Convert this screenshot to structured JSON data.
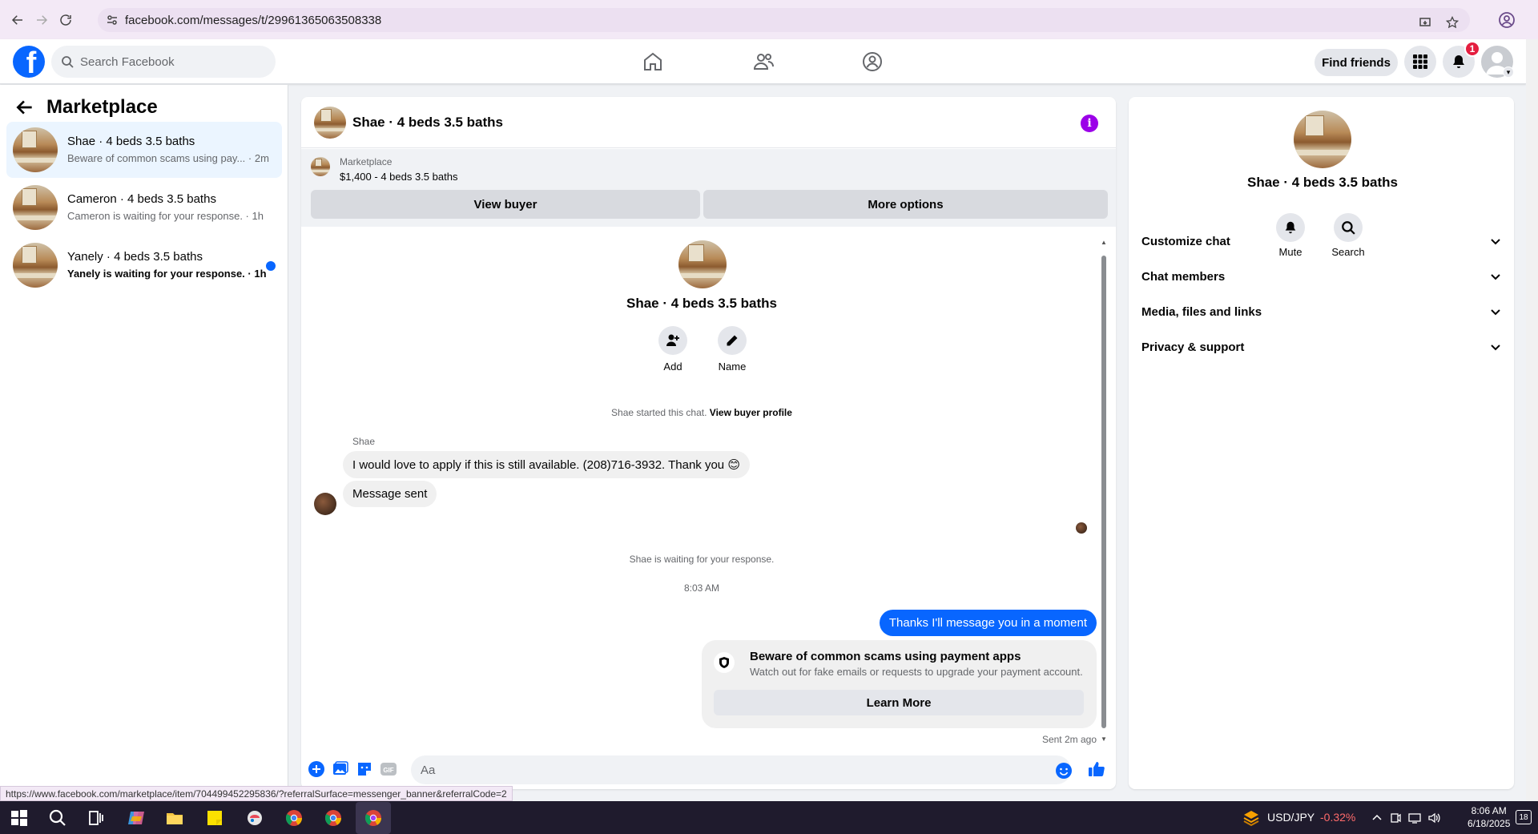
{
  "browser": {
    "url": "facebook.com/messages/t/29961365063508338",
    "status_url": "https://www.facebook.com/marketplace/item/704499452295836/?referralSurface=messenger_banner&referralCode=2"
  },
  "header": {
    "search_placeholder": "Search Facebook",
    "find_friends": "Find friends",
    "notification_count": "1"
  },
  "sidebar": {
    "title": "Marketplace",
    "conversations": [
      {
        "title": "Shae · 4 beds 3.5 baths",
        "preview": "Beware of common scams using pay... · 2m",
        "unread": false,
        "active": true
      },
      {
        "title": "Cameron · 4 beds 3.5 baths",
        "preview": "Cameron is waiting for your response. · 1h",
        "unread": false,
        "active": false
      },
      {
        "title": "Yanely · 4 beds 3.5 baths",
        "preview": "Yanely is waiting for your response. · 1h",
        "unread": true,
        "active": false
      }
    ]
  },
  "chat": {
    "title": "Shae · 4 beds 3.5 baths",
    "marketplace_label": "Marketplace",
    "listing": "$1,400 - 4 beds 3.5 baths",
    "view_buyer": "View buyer",
    "more_options": "More options",
    "profile_name": "Shae · 4 beds 3.5 baths",
    "add_label": "Add",
    "name_label": "Name",
    "started_text": "Shae started this chat.",
    "view_buyer_profile": "View buyer profile",
    "sender": "Shae",
    "msg1": "I would love to apply if this is still available. (208)716-3932. Thank you 😊",
    "msg2": "Message sent",
    "waiting": "Shae is waiting for your response.",
    "time": "8:03 AM",
    "reply": "Thanks I'll message you in a moment",
    "scam_title": "Beware of common scams using payment apps",
    "scam_sub": "Watch out for fake emails or requests to upgrade your payment account.",
    "learn_more": "Learn More",
    "sent_ago": "Sent 2m ago",
    "composer_placeholder": "Aa"
  },
  "right_panel": {
    "name": "Shae · 4 beds 3.5 baths",
    "mute": "Mute",
    "search": "Search",
    "sections": [
      "Customize chat",
      "Chat members",
      "Media, files and links",
      "Privacy & support"
    ]
  },
  "taskbar": {
    "ticker": "USD/JPY",
    "change": "-0.32%",
    "time": "8:06 AM",
    "date": "6/18/2025",
    "notif": "18"
  },
  "colors": {
    "accent": "#0866ff",
    "info": "#9b00e8",
    "badge": "#e41e3f"
  }
}
